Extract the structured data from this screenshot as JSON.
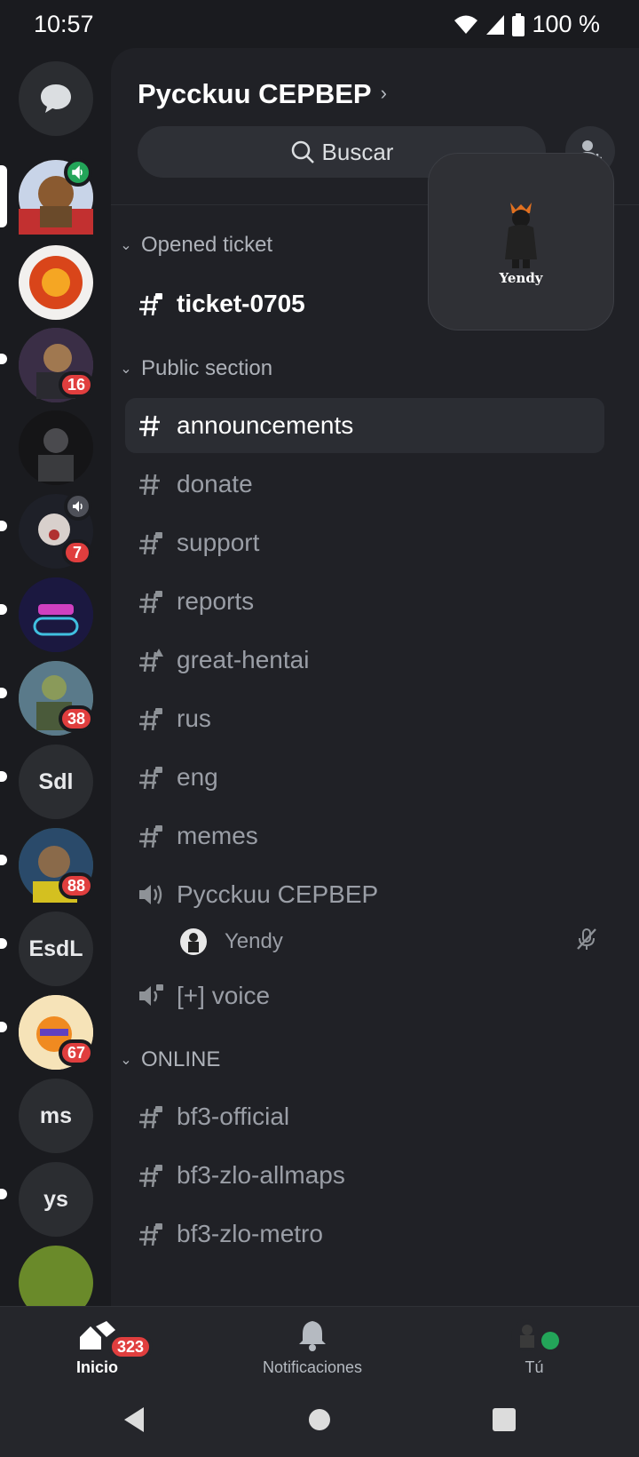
{
  "status": {
    "time": "10:57",
    "battery": "100 %"
  },
  "rail": {
    "dm_icon": "chat-bubble-icon",
    "servers": [
      {
        "kind": "avatar",
        "color": "#7a5a3e",
        "badge": null,
        "voice": "active"
      },
      {
        "kind": "avatar",
        "color": "#c24a1d",
        "badge": null
      },
      {
        "kind": "avatar",
        "color": "#4a3e52",
        "badge": "16"
      },
      {
        "kind": "avatar",
        "color": "#3a3b3e",
        "badge": null
      },
      {
        "kind": "avatar",
        "color": "#2b2d35",
        "badge": "7",
        "voice": "muted"
      },
      {
        "kind": "avatar",
        "color": "#1e1a4a",
        "badge": null
      },
      {
        "kind": "avatar",
        "color": "#5a6b4a",
        "badge": "38"
      },
      {
        "kind": "text",
        "label": "Sdl"
      },
      {
        "kind": "avatar",
        "color": "#3c5a2a",
        "badge": "88"
      },
      {
        "kind": "text",
        "label": "EsdL"
      },
      {
        "kind": "avatar",
        "color": "#f6e0b0",
        "badge": "67"
      },
      {
        "kind": "text",
        "label": "ms"
      },
      {
        "kind": "text",
        "label": "ys"
      }
    ]
  },
  "panel": {
    "server_name": "Pycckuu CEPBEP",
    "search_label": "Buscar",
    "categories": {
      "opened": "Opened ticket",
      "public": "Public section",
      "online": "ONLINE"
    },
    "channels": {
      "ticket": "ticket-0705",
      "announcements": "announcements",
      "donate": "donate",
      "support": "support",
      "reports": "reports",
      "great": "great-hentai",
      "rus": "rus",
      "eng": "eng",
      "memes": "memes",
      "voice1": "Pycckuu CEPBEP",
      "voice_user": "Yendy",
      "voice2": "[+] voice",
      "bf3official": "bf3-official",
      "bf3allmaps": "bf3-zlo-allmaps",
      "bf3metro": "bf3-zlo-metro"
    }
  },
  "pip": {
    "caption": "Yendy"
  },
  "nav": {
    "home": "Inicio",
    "home_badge": "323",
    "notifications": "Notificaciones",
    "you": "Tú"
  },
  "colors": {
    "accent_red": "#e03e3e",
    "online_green": "#23a559"
  }
}
